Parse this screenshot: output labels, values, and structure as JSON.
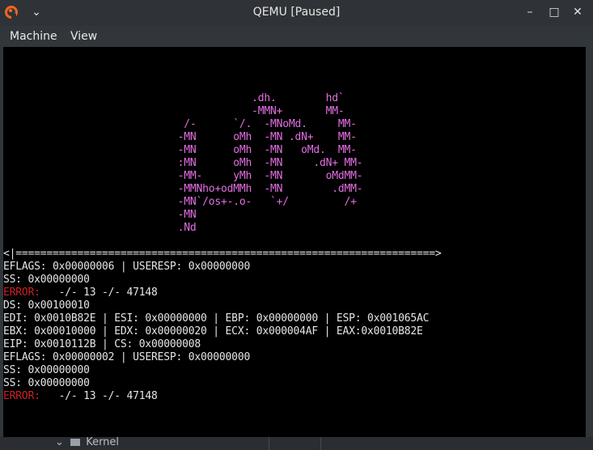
{
  "window": {
    "title": "QEMU [Paused]",
    "controls": {
      "minimize": "–",
      "maximize": "□",
      "close": "✕"
    },
    "menu": [
      "Machine",
      "View"
    ]
  },
  "screen": {
    "logo_lines": [
      "             .dh.        hd`",
      "             -MMN+       MM-",
      "  /-      `/.  -MNoMd.     MM-",
      " -MN      oMh  -MN .dN+    MM-",
      " -MN      oMh  -MN   oMd.  MM-",
      " :MN      oMh  -MN     .dN+ MM-",
      " -MM-     yMh  -MN       oMdMM-",
      " -MMNho+odMMh  -MN        .dMM-",
      " -MN`/os+-.o-   `+/         /+",
      " -MN",
      " .Nd"
    ],
    "console": {
      "separator": "<|====================================================================>",
      "lines": [
        "EFLAGS: 0x00000006 | USERESP: 0x00000000",
        "SS: 0x00000000"
      ],
      "error1_label": "ERROR:",
      "error1_rest": "   -/- 13 -/- 47148",
      "lines2": [
        "DS: 0x00100010",
        "EDI: 0x0010B82E | ESI: 0x00000000 | EBP: 0x00000000 | ESP: 0x001065AC",
        "EBX: 0x00010000 | EDX: 0x00000020 | ECX: 0x000004AF | EAX:0x0010B82E",
        "EIP: 0x0010112B | CS: 0x00000008",
        "EFLAGS: 0x00000002 | USERESP: 0x00000000",
        "SS: 0x00000000",
        "SS: 0x00000000"
      ],
      "error2_label": "ERROR:",
      "error2_rest": "   -/- 13 -/- 47148"
    }
  },
  "taskbar": {
    "item_label": "Kernel",
    "chevron": "⌄"
  },
  "colors": {
    "logo": "#e46fe3",
    "error": "#cc2222",
    "text": "#e5e5e5"
  }
}
